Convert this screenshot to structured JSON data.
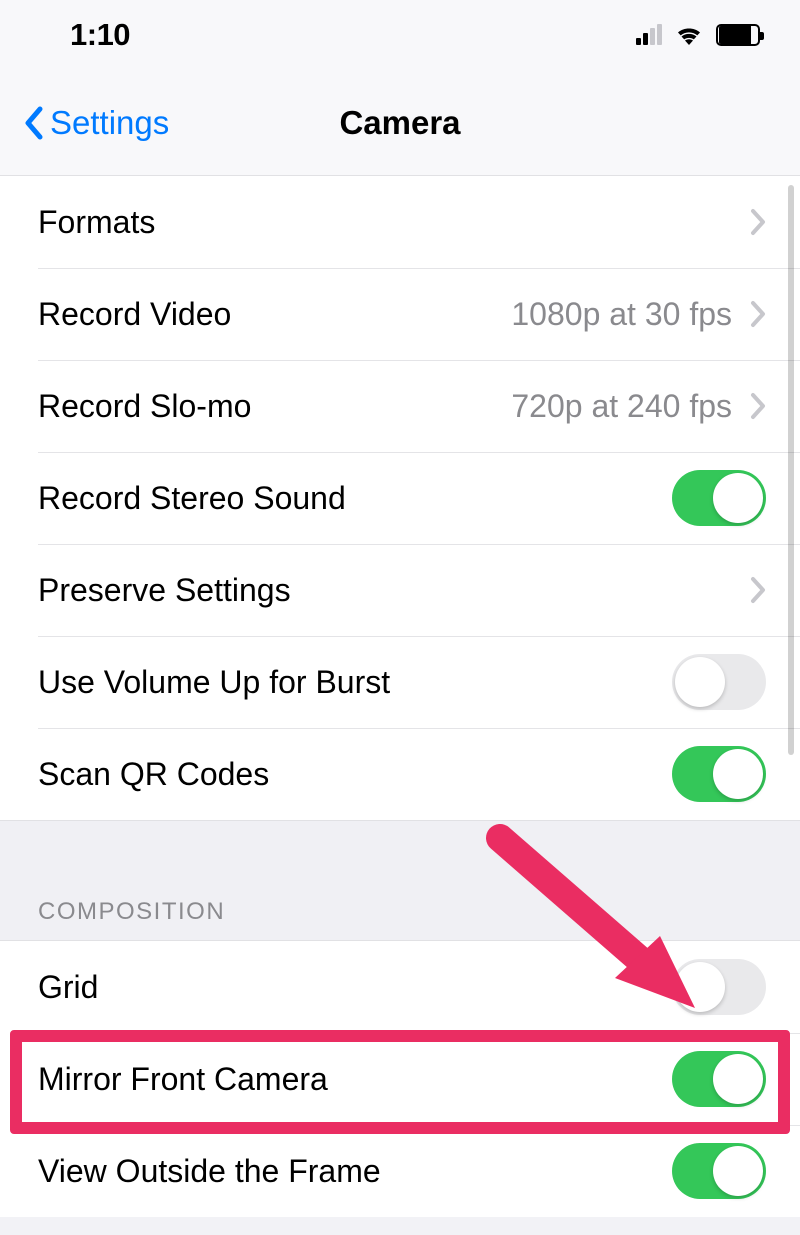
{
  "status_bar": {
    "time": "1:10"
  },
  "nav": {
    "back_label": "Settings",
    "title": "Camera"
  },
  "rows_main": {
    "formats": {
      "label": "Formats"
    },
    "record_video": {
      "label": "Record Video",
      "value": "1080p at 30 fps"
    },
    "record_slomo": {
      "label": "Record Slo-mo",
      "value": "720p at 240 fps"
    },
    "stereo_sound": {
      "label": "Record Stereo Sound",
      "on": true
    },
    "preserve": {
      "label": "Preserve Settings"
    },
    "volume_burst": {
      "label": "Use Volume Up for Burst",
      "on": false
    },
    "scan_qr": {
      "label": "Scan QR Codes",
      "on": true
    }
  },
  "section_headers": {
    "composition": "COMPOSITION"
  },
  "rows_composition": {
    "grid": {
      "label": "Grid",
      "on": false
    },
    "mirror": {
      "label": "Mirror Front Camera",
      "on": true
    },
    "view_outside": {
      "label": "View Outside the Frame",
      "on": true
    }
  },
  "annotation": {
    "highlight_color": "#ea2d62"
  }
}
